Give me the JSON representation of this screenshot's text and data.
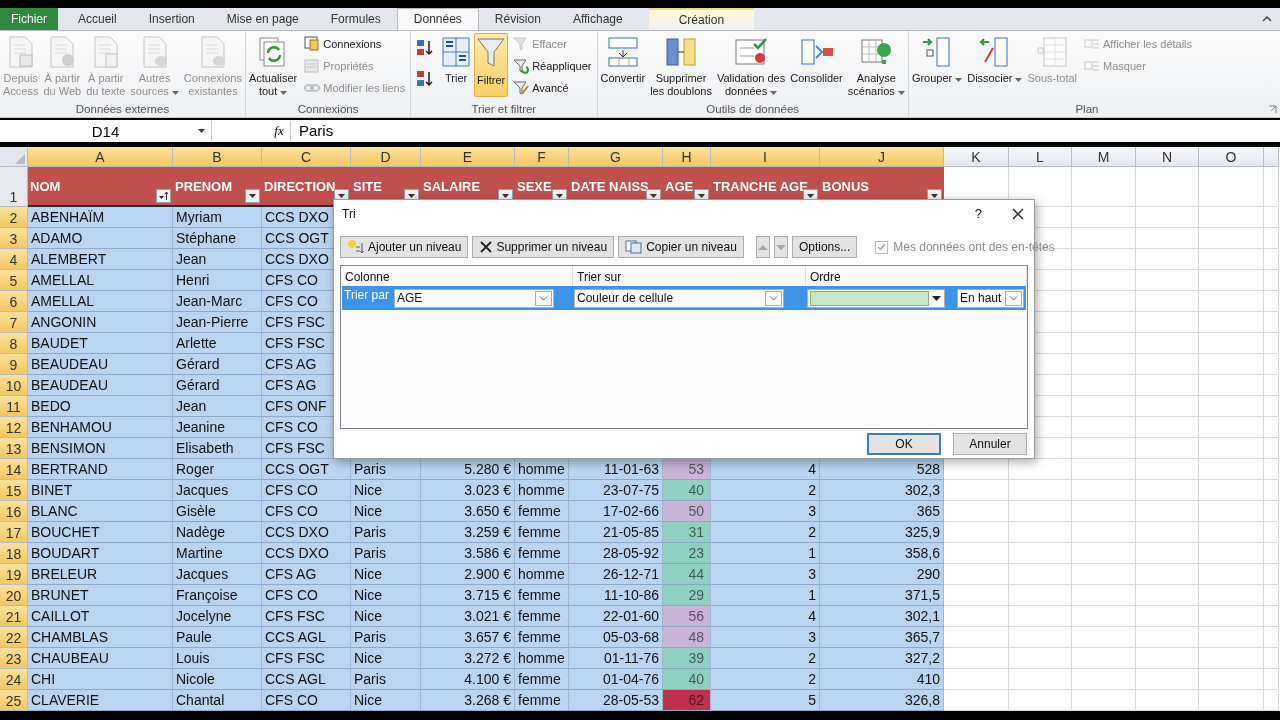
{
  "tabs": [
    {
      "label": "Fichier",
      "kind": "file",
      "selected": false
    },
    {
      "label": "Accueil",
      "kind": "plain",
      "selected": false
    },
    {
      "label": "Insertion",
      "kind": "plain",
      "selected": false
    },
    {
      "label": "Mise en page",
      "kind": "plain",
      "selected": false
    },
    {
      "label": "Formules",
      "kind": "plain",
      "selected": false
    },
    {
      "label": "Données",
      "kind": "plain",
      "selected": true
    },
    {
      "label": "Révision",
      "kind": "plain",
      "selected": false
    },
    {
      "label": "Affichage",
      "kind": "plain",
      "selected": false
    },
    {
      "label": "Création",
      "kind": "contextual",
      "selected": false
    }
  ],
  "ribbon": {
    "groups": [
      {
        "label": "Données externes",
        "items": [
          {
            "kind": "large",
            "label": "Depuis\nAccess",
            "disabled": true,
            "selected": false
          },
          {
            "kind": "large",
            "label": "À partir\ndu Web",
            "disabled": true,
            "selected": false
          },
          {
            "kind": "large",
            "label": "À partir\ndu texte",
            "disabled": true,
            "selected": false
          },
          {
            "kind": "large",
            "label": "Autres\nsources",
            "disabled": true,
            "selected": false,
            "dropdown": true
          },
          {
            "kind": "large",
            "label": "Connexions\nexistantes",
            "disabled": true,
            "selected": false
          }
        ]
      },
      {
        "label": "Connexions",
        "items": [
          {
            "kind": "large",
            "label": "Actualiser\ntout",
            "disabled": false,
            "selected": false,
            "dropdown": true
          },
          {
            "kind": "small",
            "label": "Connexions",
            "disabled": false,
            "selected": false
          },
          {
            "kind": "small",
            "label": "Propriétés",
            "disabled": true,
            "selected": false
          },
          {
            "kind": "small",
            "label": "Modifier les liens",
            "disabled": true,
            "selected": false
          }
        ]
      },
      {
        "label": "Trier et filtrer",
        "items": [
          {
            "kind": "icon",
            "disabled": false,
            "selected": false
          },
          {
            "kind": "icon",
            "disabled": false,
            "selected": false
          },
          {
            "kind": "large",
            "label": "Trier",
            "disabled": false,
            "selected": false
          },
          {
            "kind": "large",
            "label": "Filtrer",
            "disabled": false,
            "selected": true
          },
          {
            "kind": "small",
            "label": "Effacer",
            "disabled": true,
            "selected": false
          },
          {
            "kind": "small",
            "label": "Réappliquer",
            "disabled": false,
            "selected": false
          },
          {
            "kind": "small",
            "label": "Avancé",
            "disabled": false,
            "selected": false
          }
        ]
      },
      {
        "label": "Outils de données",
        "items": [
          {
            "kind": "large",
            "label": "Convertir",
            "disabled": false,
            "selected": false
          },
          {
            "kind": "large",
            "label": "Supprimer\nles doublons",
            "disabled": false,
            "selected": false
          },
          {
            "kind": "large",
            "label": "Validation des\ndonnées",
            "disabled": false,
            "selected": false,
            "dropdown": true
          },
          {
            "kind": "large",
            "label": "Consolider",
            "disabled": false,
            "selected": false
          },
          {
            "kind": "large",
            "label": "Analyse\nscénarios",
            "disabled": false,
            "selected": false,
            "dropdown": true
          }
        ]
      },
      {
        "label": "Plan",
        "launcher": true,
        "items": [
          {
            "kind": "large",
            "label": "Grouper",
            "disabled": false,
            "selected": false,
            "dropdown": true
          },
          {
            "kind": "large",
            "label": "Dissocier",
            "disabled": false,
            "selected": false,
            "dropdown": true
          },
          {
            "kind": "large",
            "label": "Sous-total",
            "disabled": true,
            "selected": false
          },
          {
            "kind": "small",
            "label": "Afficher les détails",
            "disabled": true,
            "selected": false
          },
          {
            "kind": "small",
            "label": "Masquer",
            "disabled": true,
            "selected": false
          }
        ]
      }
    ]
  },
  "formula_bar": {
    "name_box": "D14",
    "function_label": "fx",
    "formula": "Paris"
  },
  "sheet": {
    "columns": [
      {
        "letter": "A",
        "selected": true
      },
      {
        "letter": "B",
        "selected": true
      },
      {
        "letter": "C",
        "selected": true
      },
      {
        "letter": "D",
        "selected": true
      },
      {
        "letter": "E",
        "selected": true
      },
      {
        "letter": "F",
        "selected": true
      },
      {
        "letter": "G",
        "selected": true
      },
      {
        "letter": "H",
        "selected": true
      },
      {
        "letter": "I",
        "selected": true
      },
      {
        "letter": "J",
        "selected": true
      },
      {
        "letter": "K",
        "selected": false
      },
      {
        "letter": "L",
        "selected": false
      },
      {
        "letter": "M",
        "selected": false
      },
      {
        "letter": "N",
        "selected": false
      },
      {
        "letter": "O",
        "selected": false
      }
    ],
    "header_row": {
      "num": "1",
      "selected": false,
      "cells": [
        {
          "text": "NOM",
          "sorted": true
        },
        {
          "text": "PRENOM",
          "sorted": false
        },
        {
          "text": "DIRECTION",
          "sorted": false
        },
        {
          "text": "SITE",
          "sorted": false
        },
        {
          "text": "SALAIRE",
          "sorted": false
        },
        {
          "text": "SEXE",
          "sorted": false
        },
        {
          "text": "DATE NAISS",
          "sorted": false
        },
        {
          "text": "AGE",
          "sorted": false
        },
        {
          "text": "TRANCHE AGE",
          "sorted": false
        },
        {
          "text": "BONUS",
          "sorted": false
        }
      ]
    },
    "rows": [
      {
        "num": "2",
        "selected": true,
        "cells": [
          "ABENHAÏM",
          "Myriam",
          "CCS DXO"
        ]
      },
      {
        "num": "3",
        "selected": true,
        "cells": [
          "ADAMO",
          "Stéphane",
          "CCS OGT"
        ]
      },
      {
        "num": "4",
        "selected": true,
        "cells": [
          "ALEMBERT",
          "Jean",
          "CCS DXO"
        ]
      },
      {
        "num": "5",
        "selected": true,
        "cells": [
          "AMELLAL",
          "Henri",
          "CFS CO"
        ]
      },
      {
        "num": "6",
        "selected": true,
        "cells": [
          "AMELLAL",
          "Jean-Marc",
          "CFS CO"
        ]
      },
      {
        "num": "7",
        "selected": true,
        "cells": [
          "ANGONIN",
          "Jean-Pierre",
          "CFS FSC"
        ]
      },
      {
        "num": "8",
        "selected": true,
        "cells": [
          "BAUDET",
          "Arlette",
          "CFS FSC"
        ]
      },
      {
        "num": "9",
        "selected": true,
        "cells": [
          "BEAUDEAU",
          "Gérard",
          "CFS AG"
        ]
      },
      {
        "num": "10",
        "selected": true,
        "cells": [
          "BEAUDEAU",
          "Gérard",
          "CFS AG"
        ]
      },
      {
        "num": "11",
        "selected": true,
        "cells": [
          "BEDO",
          "Jean",
          "CFS ONF"
        ]
      },
      {
        "num": "12",
        "selected": true,
        "cells": [
          "BENHAMOU",
          "Jeanine",
          "CFS CO"
        ]
      },
      {
        "num": "13",
        "selected": true,
        "cells": [
          "BENSIMON",
          "Elisabeth",
          "CFS FSC"
        ]
      },
      {
        "num": "14",
        "selected": true,
        "cells": [
          "BERTRAND",
          "Roger",
          "CCS OGT",
          "Paris",
          "5.280 €",
          "homme",
          "11-01-63",
          "53",
          "4",
          "528"
        ],
        "color": "#c9b4d8"
      },
      {
        "num": "15",
        "selected": true,
        "cells": [
          "BINET",
          "Jacques",
          "CFS CO",
          "Nice",
          "3.023 €",
          "homme",
          "23-07-75",
          "40",
          "2",
          "302,3"
        ],
        "color": "#8fd0c2"
      },
      {
        "num": "16",
        "selected": true,
        "cells": [
          "BLANC",
          "Gisèle",
          "CFS CO",
          "Nice",
          "3.650 €",
          "femme",
          "17-02-66",
          "50",
          "3",
          "365"
        ],
        "color": "#c9b4d8"
      },
      {
        "num": "17",
        "selected": true,
        "cells": [
          "BOUCHET",
          "Nadège",
          "CCS DXO",
          "Paris",
          "3.259 €",
          "femme",
          "21-05-85",
          "31",
          "2",
          "325,9"
        ],
        "color": "#8fd0c2"
      },
      {
        "num": "18",
        "selected": true,
        "cells": [
          "BOUDART",
          "Martine",
          "CCS DXO",
          "Paris",
          "3.586 €",
          "femme",
          "28-05-92",
          "23",
          "1",
          "358,6"
        ],
        "color": "#8fd0c2"
      },
      {
        "num": "19",
        "selected": true,
        "cells": [
          "BRELEUR",
          "Jacques",
          "CFS AG",
          "Nice",
          "2.900 €",
          "homme",
          "26-12-71",
          "44",
          "3",
          "290"
        ],
        "color": "#8fd0c2"
      },
      {
        "num": "20",
        "selected": true,
        "cells": [
          "BRUNET",
          "Françoise",
          "CFS CO",
          "Nice",
          "3.715 €",
          "femme",
          "11-10-86",
          "29",
          "1",
          "371,5"
        ],
        "color": "#8fd0c2"
      },
      {
        "num": "21",
        "selected": true,
        "cells": [
          "CAILLOT",
          "Jocelyne",
          "CFS FSC",
          "Nice",
          "3.021 €",
          "femme",
          "22-01-60",
          "56",
          "4",
          "302,1"
        ],
        "color": "#c9b4d8"
      },
      {
        "num": "22",
        "selected": true,
        "cells": [
          "CHAMBLAS",
          "Paule",
          "CCS AGL",
          "Paris",
          "3.657 €",
          "femme",
          "05-03-68",
          "48",
          "3",
          "365,7"
        ],
        "color": "#c9b4d8"
      },
      {
        "num": "23",
        "selected": true,
        "cells": [
          "CHAUBEAU",
          "Louis",
          "CFS FSC",
          "Nice",
          "3.272 €",
          "homme",
          "01-11-76",
          "39",
          "2",
          "327,2"
        ],
        "color": "#8fd0c2"
      },
      {
        "num": "24",
        "selected": true,
        "cells": [
          "CHI",
          "Nicole",
          "CCS AGL",
          "Paris",
          "4.100 €",
          "femme",
          "01-04-76",
          "40",
          "2",
          "410"
        ],
        "color": "#8fd0c2"
      },
      {
        "num": "25",
        "selected": true,
        "cells": [
          "CLAVERIE",
          "Chantal",
          "CFS CO",
          "Nice",
          "3.268 €",
          "femme",
          "28-05-53",
          "62",
          "5",
          "326,8"
        ],
        "color": "#c0304c"
      }
    ]
  },
  "dialog": {
    "title": "Tri",
    "help": "?",
    "toolbar": [
      {
        "kind": "add",
        "label": "Ajouter un niveau",
        "disabled": false
      },
      {
        "kind": "delete",
        "label": "Supprimer un niveau",
        "disabled": false
      },
      {
        "kind": "copy",
        "label": "Copier un niveau",
        "disabled": false
      },
      {
        "kind": "up",
        "disabled": true
      },
      {
        "kind": "down",
        "disabled": true
      },
      {
        "kind": "text",
        "label": "Options...",
        "disabled": false
      }
    ],
    "headers_checkbox": {
      "label": "Mes données ont des en-têtes",
      "checked": true,
      "disabled": true
    },
    "columns": [
      "Colonne",
      "Trier sur",
      "Ordre"
    ],
    "levels": [
      {
        "label": "Trier par",
        "selected": true,
        "column": "AGE",
        "sort_on": "Couleur de cellule",
        "color": "#c4e8c9",
        "position": "En haut"
      }
    ],
    "buttons": [
      {
        "label": "OK",
        "default": true
      },
      {
        "label": "Annuler",
        "default": false
      }
    ]
  }
}
